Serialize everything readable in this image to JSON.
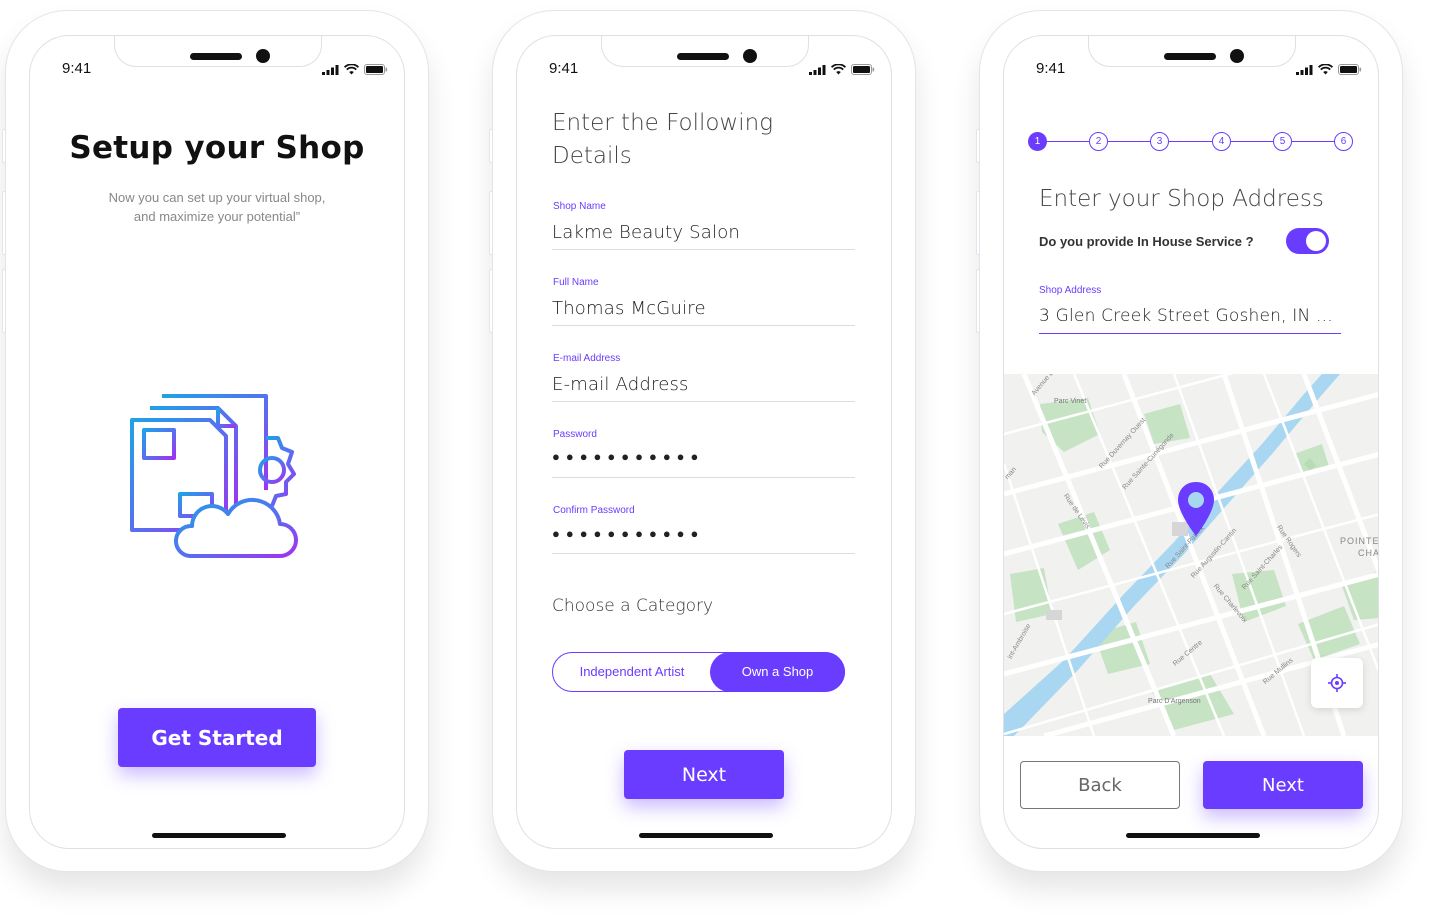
{
  "status_time": "9:41",
  "screen1": {
    "title": "Setup your Shop",
    "subtitle_line1": "Now you can set up your virtual shop,",
    "subtitle_line2": "and maximize your potential”",
    "cta_label": "Get Started"
  },
  "screen2": {
    "heading_line1": "Enter the Following",
    "heading_line2": "Details",
    "fields": [
      {
        "label": "Shop Name",
        "value": "Lakme Beauty Salon"
      },
      {
        "label": "Full Name",
        "value": "Thomas McGuire"
      },
      {
        "label": "E-mail Address",
        "value": "E-mail Address"
      },
      {
        "label": "Password",
        "value": "●●●●●●●●●●●"
      },
      {
        "label": "Confirm  Password",
        "value": "●●●●●●●●●●●"
      }
    ],
    "category_heading": "Choose a Category",
    "category_options": [
      "Independent Artist",
      "Own a Shop"
    ],
    "selected_category": "Own a Shop",
    "next_label": "Next"
  },
  "screen3": {
    "steps": [
      "1",
      "2",
      "3",
      "4",
      "5",
      "6"
    ],
    "current_step": 1,
    "heading": "Enter your Shop Address",
    "in_house_question": "Do you provide In House Service ?",
    "in_house_enabled": true,
    "address_label": "Shop Address",
    "address_value": "3 Glen Creek Street Goshen, IN ...",
    "map_labels": [
      "Avenue L",
      "Parc Vinet",
      "Rue Duvernay Ouest",
      "Rue Sainte-Cunégonde",
      "man",
      "Rue de Lévis",
      "Rue Saint-Patrick",
      "Rue Augustin-Cantin",
      "Rue Saint-Charles",
      "Rue Rogers",
      "Rue Charlevoix",
      "POINTE",
      "CHA",
      "Rue Centre",
      "Rue Mullins",
      "Parc D'Argenson",
      "int-Ambroise"
    ],
    "back_label": "Back",
    "next_label": "Next"
  },
  "colors": {
    "accent": "#6a3cff",
    "map_water": "#aadaff",
    "map_park": "#c8e6c9"
  }
}
